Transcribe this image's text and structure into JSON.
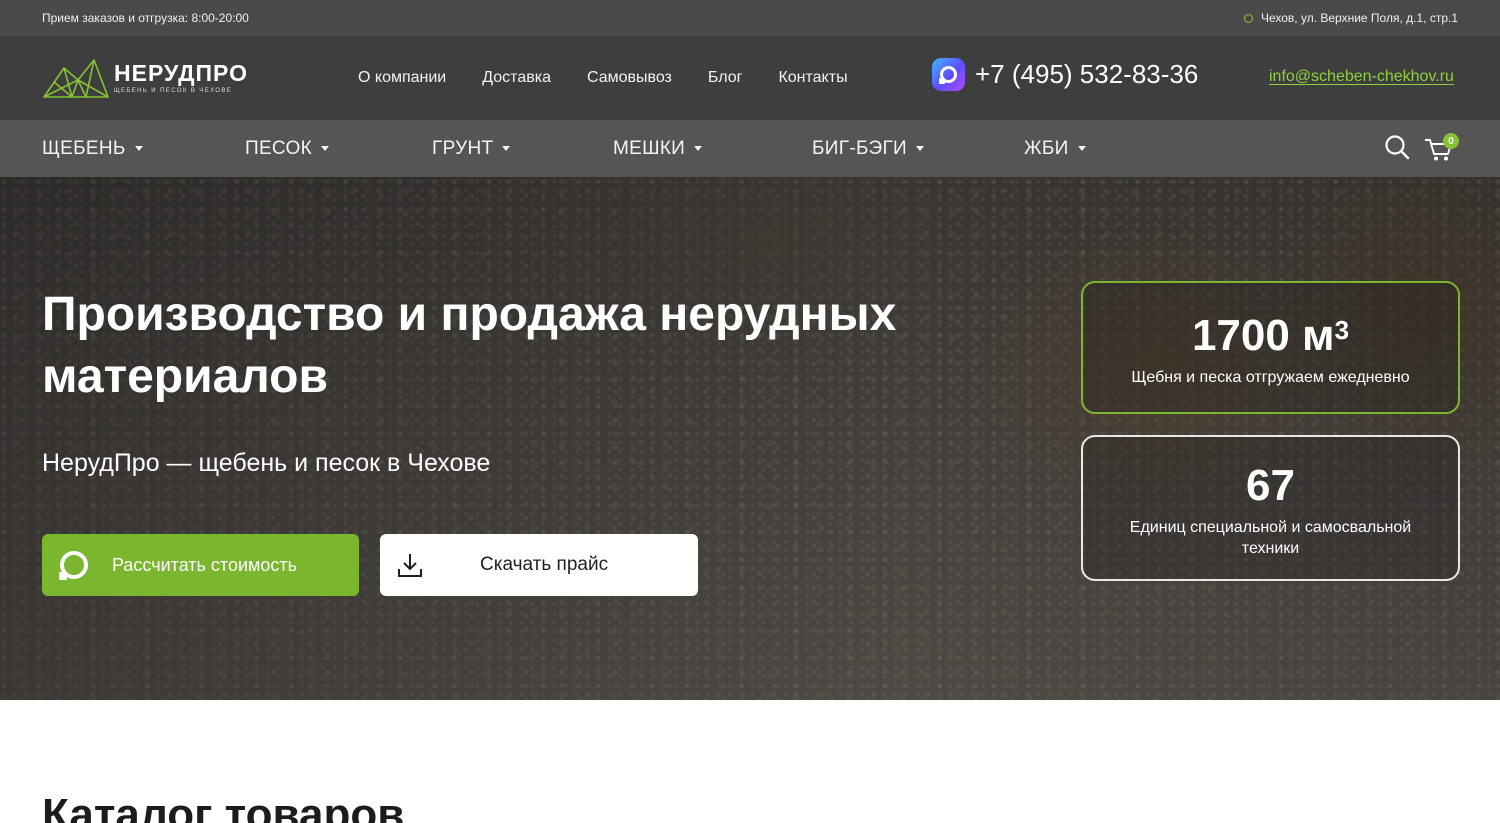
{
  "topbar": {
    "hours": "Прием заказов и отгрузка: 8:00-20:00",
    "address": "Чехов, ул. Верхние Поля, д.1, стр.1"
  },
  "header": {
    "logo_name": "НЕРУДПРО",
    "logo_tagline": "щебень и песок в чехове",
    "nav": [
      "О компании",
      "Доставка",
      "Самовывоз",
      "Блог",
      "Контакты"
    ],
    "phone": "+7 (495) 532-83-36",
    "email": "info@scheben-chekhov.ru"
  },
  "categories": [
    "ЩЕБЕНЬ",
    "ПЕСОК",
    "ГРУНТ",
    "МЕШКИ",
    "БИГ-БЭГИ",
    "ЖБИ"
  ],
  "cart": {
    "count": "0"
  },
  "hero": {
    "title": "Производство и продажа нерудных материалов",
    "subtitle": "НерудПро — щебень и песок в Чехове",
    "calc_button": "Рассчитать стоимость",
    "price_button": "Скачать прайс"
  },
  "stats": [
    {
      "value": "1700 м",
      "sup": "3",
      "label": "Щебня и песка отгружаем ежедневно"
    },
    {
      "value": "67",
      "label": "Единиц специальной и самосвальной техники"
    }
  ],
  "catalog": {
    "title": "Каталог товаров"
  },
  "colors": {
    "accent": "#7ab72e",
    "link": "#8fd13c",
    "topbar": "#4a4a4a",
    "header": "#3e3e3e",
    "catbar": "#555555"
  }
}
